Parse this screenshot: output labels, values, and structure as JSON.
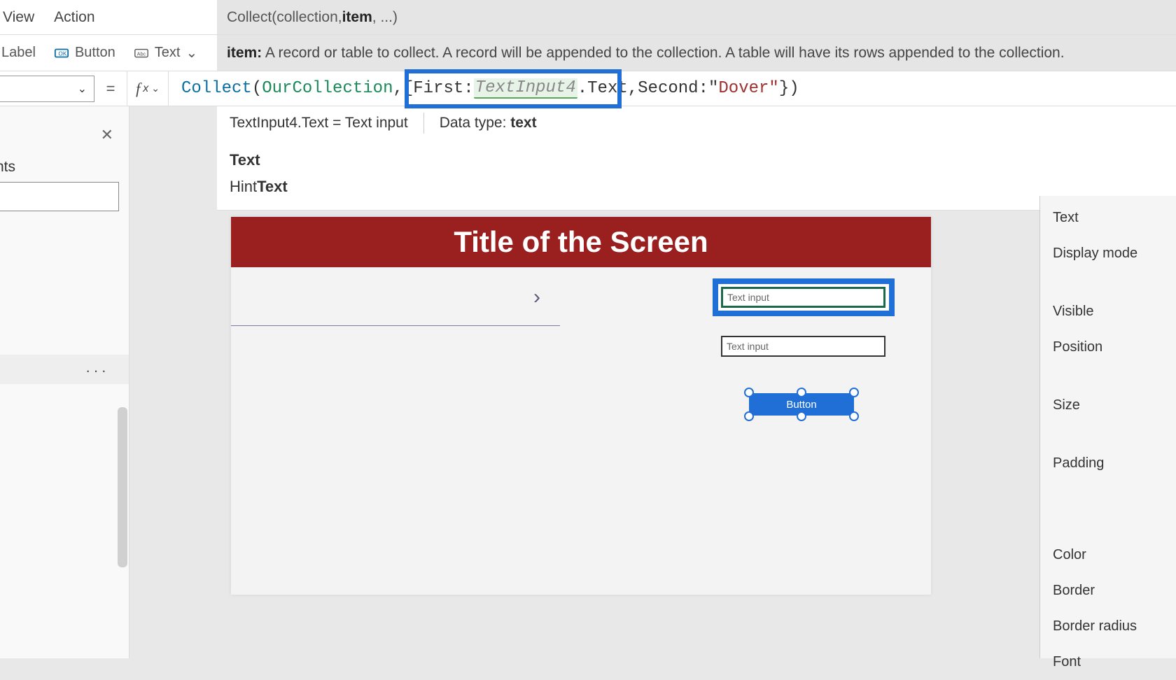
{
  "menubar": {
    "view": "View",
    "action": "Action"
  },
  "signature": {
    "fn": "Collect",
    "args": "(collection, ",
    "bold": "item",
    "rest": ", ...)"
  },
  "ribbon": {
    "label": "Label",
    "button": "Button",
    "text": "Text",
    "desc_bold": "item:",
    "desc": " A record or table to collect. A record will be appended to the collection. A table will have its rows appended to the collection."
  },
  "formula": {
    "fn": "Collect",
    "p1": "(",
    "coll": "OurCollection",
    "c1": ", ",
    "brace": "{First: ",
    "ti": "TextInput4",
    "dot": ".Text, ",
    "second": "Second: ",
    "cursor": "\"",
    "str": "Dover\"",
    "end": "})"
  },
  "intelli": {
    "left": "TextInput4.Text  =  Text input",
    "dt_label": "Data type: ",
    "dt_val": "text",
    "s1a": "",
    "s1b": "Text",
    "s2a": "Hint",
    "s2b": "Text"
  },
  "leftpanel": {
    "header": "nts",
    "dots": "···"
  },
  "canvas": {
    "title": "Title of the Screen",
    "text_input_ph": "Text input",
    "button_label": "Button"
  },
  "props": {
    "text": "Text",
    "display_mode": "Display mode",
    "visible": "Visible",
    "position": "Position",
    "size": "Size",
    "padding": "Padding",
    "color": "Color",
    "border": "Border",
    "border_radius": "Border radius",
    "font": "Font"
  }
}
